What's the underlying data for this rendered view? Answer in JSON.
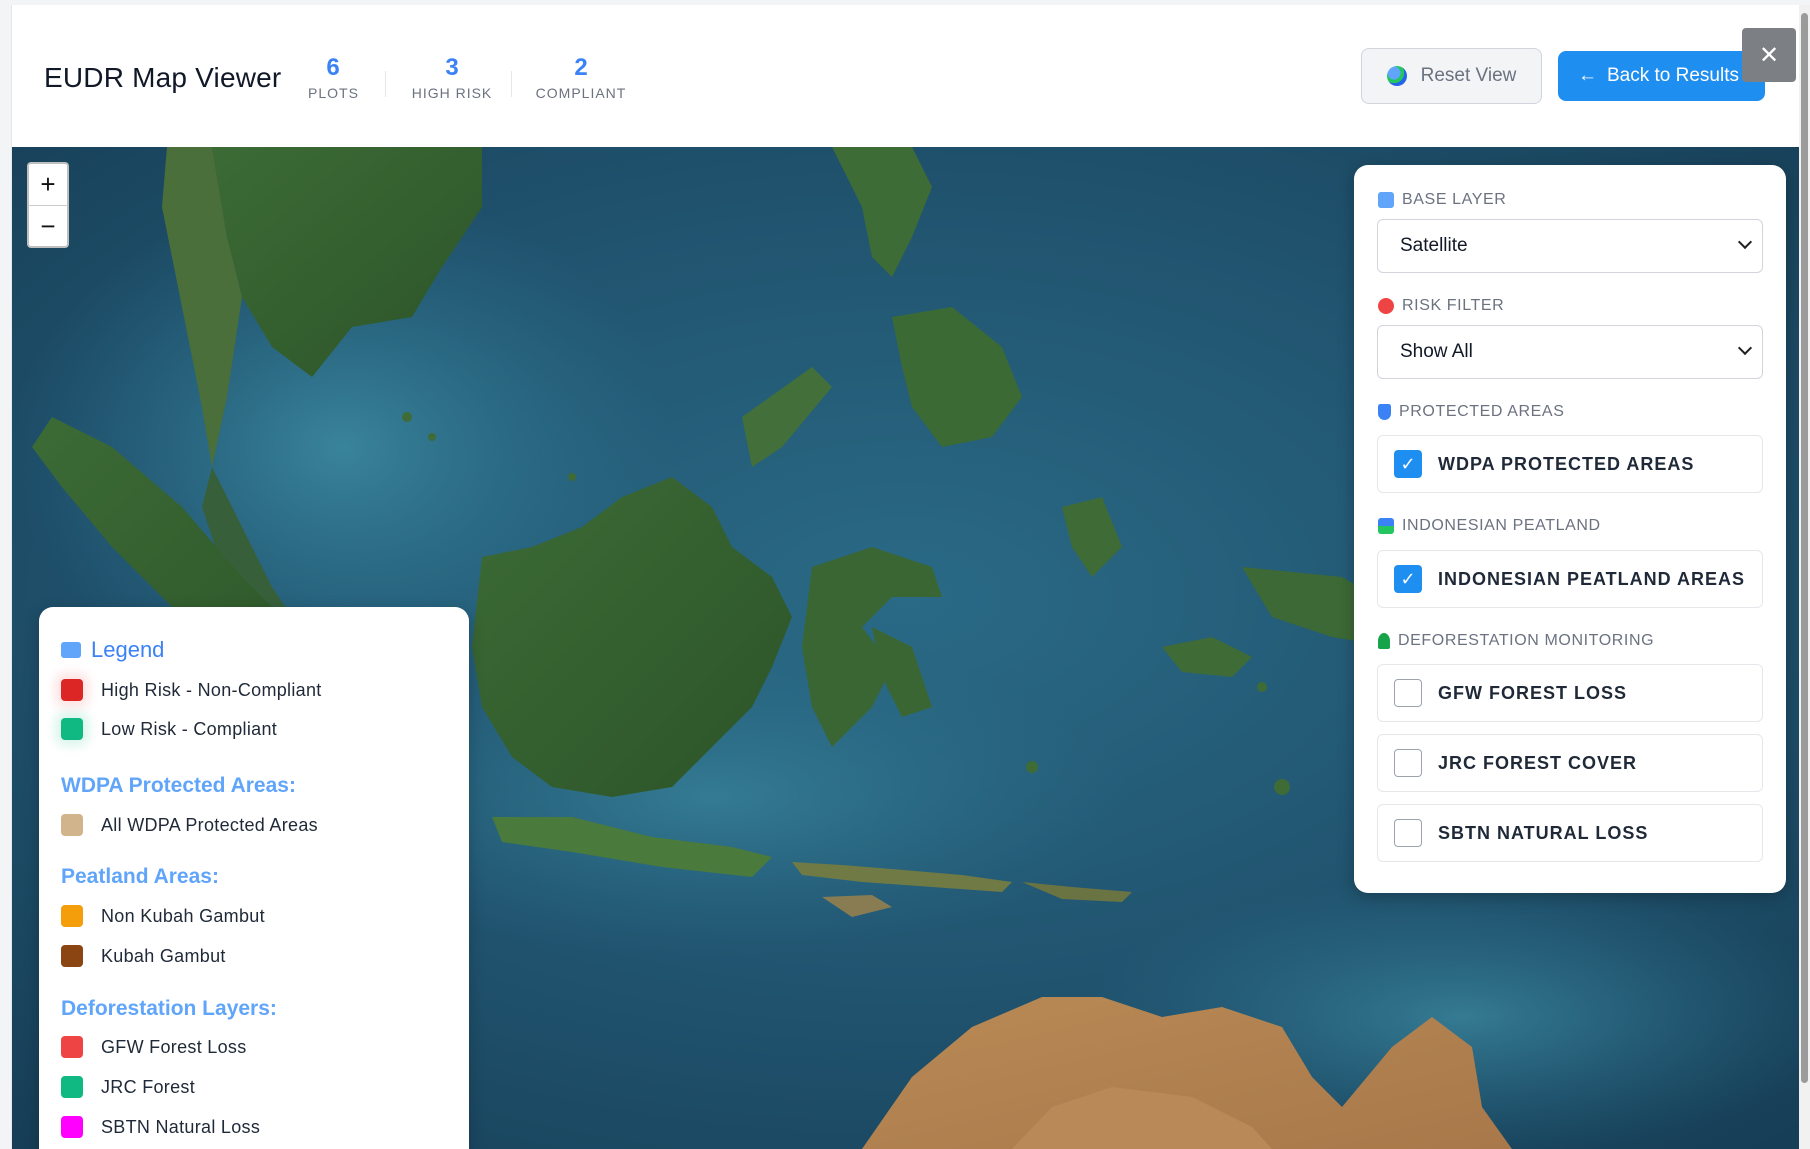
{
  "header": {
    "title": "EUDR Map Viewer",
    "stats": [
      {
        "value": "6",
        "label": "PLOTS"
      },
      {
        "value": "3",
        "label": "HIGH RISK"
      },
      {
        "value": "2",
        "label": "COMPLIANT"
      }
    ],
    "reset_label": "Reset View",
    "back_label": "Back to Results",
    "back_arrow": "←",
    "close_glyph": "✕"
  },
  "zoom": {
    "in": "+",
    "out": "−"
  },
  "controls": {
    "base_layer": {
      "title": "BASE LAYER",
      "value": "Satellite"
    },
    "risk_filter": {
      "title": "RISK FILTER",
      "value": "Show All"
    },
    "protected_areas": {
      "title": "PROTECTED AREAS",
      "option": "WDPA PROTECTED AREAS",
      "checked": true
    },
    "peatland": {
      "title": "INDONESIAN PEATLAND",
      "option": "INDONESIAN PEATLAND AREAS",
      "checked": true
    },
    "deforestation": {
      "title": "DEFORESTATION MONITORING",
      "options": [
        {
          "label": "GFW FOREST LOSS",
          "checked": false
        },
        {
          "label": "JRC FOREST COVER",
          "checked": false
        },
        {
          "label": "SBTN NATURAL LOSS",
          "checked": false
        }
      ]
    }
  },
  "legend": {
    "title": "Legend",
    "risk_items": [
      {
        "label": "High Risk - Non-Compliant",
        "color": "#dc2626"
      },
      {
        "label": "Low Risk - Compliant",
        "color": "#10b981"
      }
    ],
    "wdpa": {
      "heading": "WDPA Protected Areas:",
      "items": [
        {
          "label": "All WDPA Protected Areas",
          "color": "#d2b48c"
        }
      ]
    },
    "peatland": {
      "heading": "Peatland Areas:",
      "items": [
        {
          "label": "Non Kubah Gambut",
          "color": "#f59e0b"
        },
        {
          "label": "Kubah Gambut",
          "color": "#8b4513"
        }
      ]
    },
    "deforestation": {
      "heading": "Deforestation Layers:",
      "items": [
        {
          "label": "GFW Forest Loss",
          "color": "#ef4444"
        },
        {
          "label": "JRC Forest",
          "color": "#10b981"
        },
        {
          "label": "SBTN Natural Loss",
          "color": "#ff00ff"
        }
      ]
    }
  },
  "colors": {
    "accent": "#1f8ef1",
    "stat_blue": "#3b82f6",
    "legend_heading": "#60a5fa"
  }
}
